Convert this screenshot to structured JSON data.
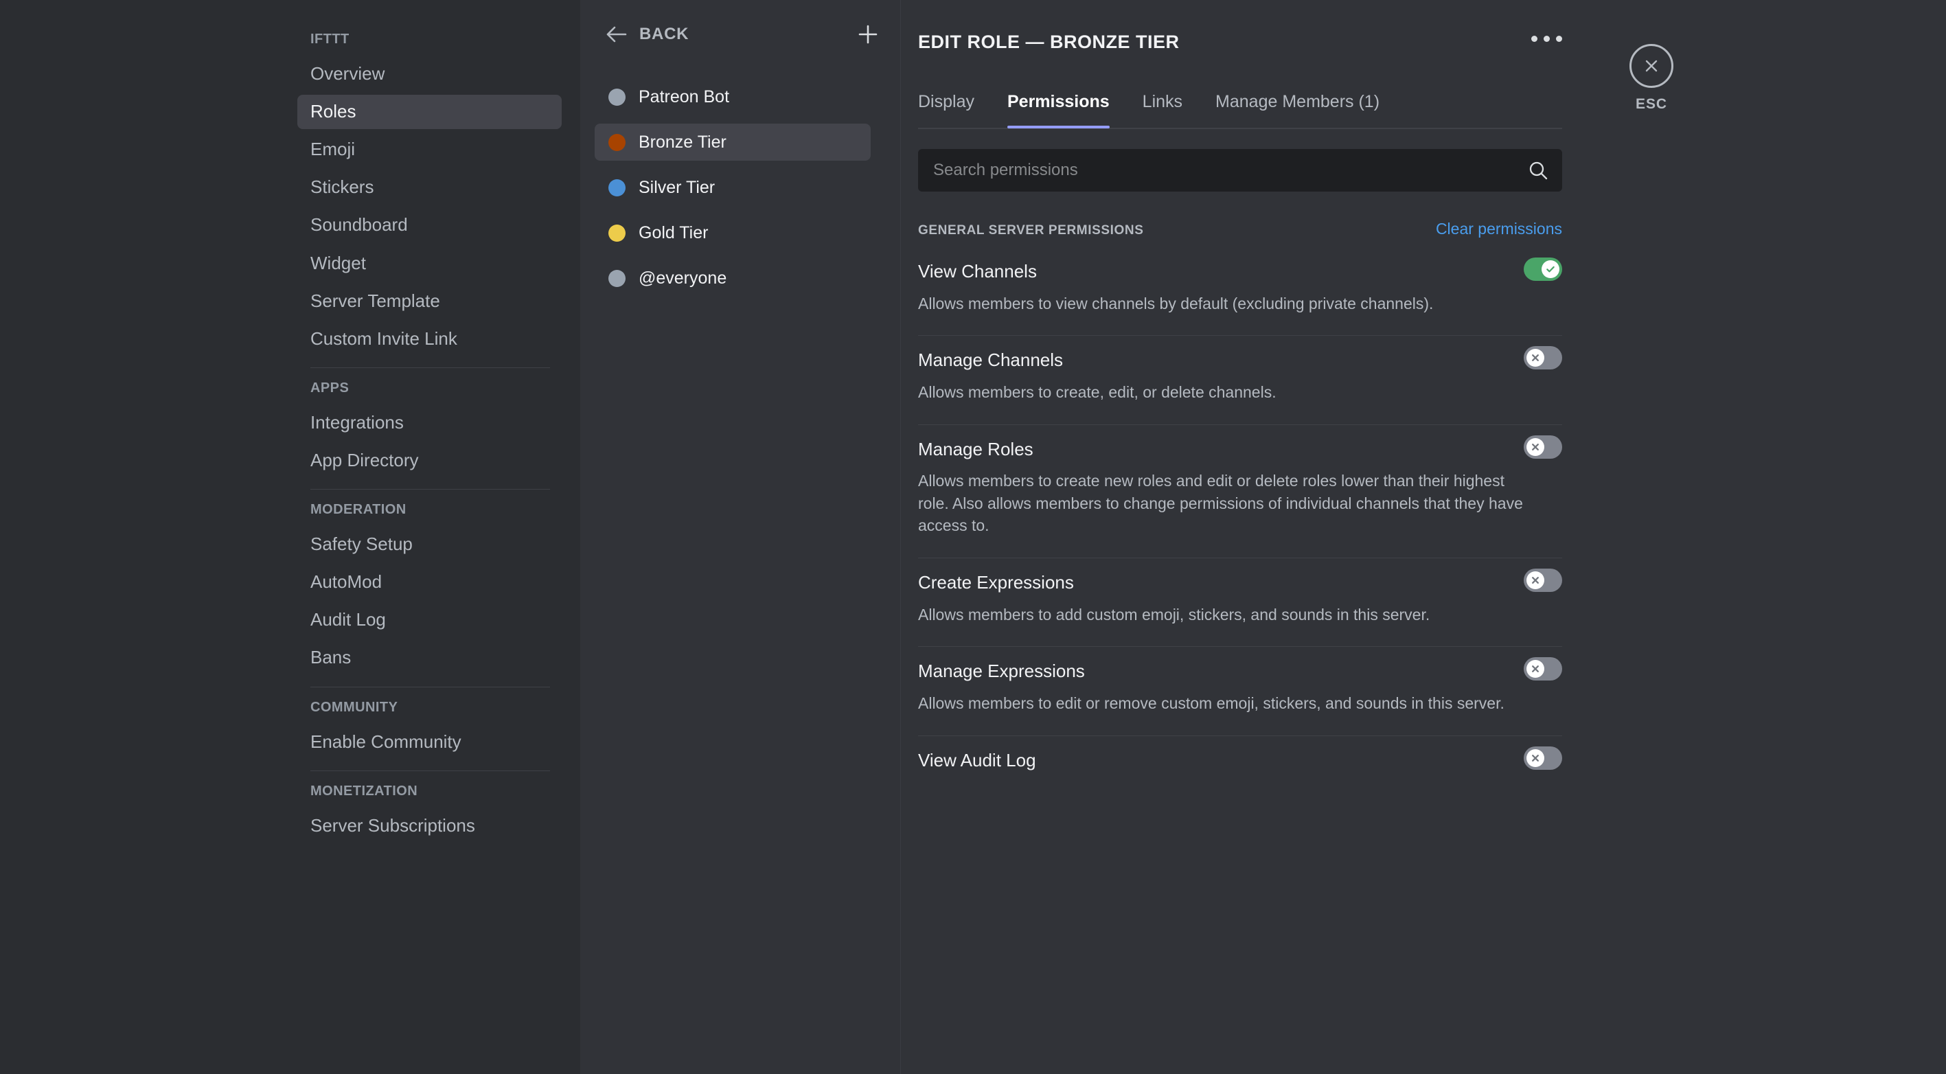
{
  "sidebar": {
    "groups": [
      {
        "header": "IFTTT",
        "items": [
          {
            "label": "Overview",
            "active": false
          },
          {
            "label": "Roles",
            "active": true
          },
          {
            "label": "Emoji",
            "active": false
          },
          {
            "label": "Stickers",
            "active": false
          },
          {
            "label": "Soundboard",
            "active": false
          },
          {
            "label": "Widget",
            "active": false
          },
          {
            "label": "Server Template",
            "active": false
          },
          {
            "label": "Custom Invite Link",
            "active": false
          }
        ]
      },
      {
        "header": "APPS",
        "items": [
          {
            "label": "Integrations",
            "active": false
          },
          {
            "label": "App Directory",
            "active": false
          }
        ]
      },
      {
        "header": "MODERATION",
        "items": [
          {
            "label": "Safety Setup",
            "active": false
          },
          {
            "label": "AutoMod",
            "active": false
          },
          {
            "label": "Audit Log",
            "active": false
          },
          {
            "label": "Bans",
            "active": false
          }
        ]
      },
      {
        "header": "COMMUNITY",
        "items": [
          {
            "label": "Enable Community",
            "active": false
          }
        ]
      },
      {
        "header": "MONETIZATION",
        "items": [
          {
            "label": "Server Subscriptions",
            "active": false
          }
        ]
      }
    ]
  },
  "roles_panel": {
    "back_label": "BACK",
    "add_role_icon": "plus-icon",
    "back_icon": "arrow-left-icon",
    "roles": [
      {
        "name": "Patreon Bot",
        "color": "#9aa4b0",
        "active": false
      },
      {
        "name": "Bronze Tier",
        "color": "#a84300",
        "active": true
      },
      {
        "name": "Silver Tier",
        "color": "#4b90d6",
        "active": false
      },
      {
        "name": "Gold Tier",
        "color": "#edcc4b",
        "active": false
      },
      {
        "name": "@everyone",
        "color": "#9aa4b0",
        "active": false
      }
    ]
  },
  "header": {
    "title": "EDIT ROLE — BRONZE TIER",
    "more_icon": "more-horizontal-icon"
  },
  "tabs": [
    {
      "label": "Display",
      "active": false
    },
    {
      "label": "Permissions",
      "active": true
    },
    {
      "label": "Links",
      "active": false
    },
    {
      "label": "Manage Members (1)",
      "active": false
    }
  ],
  "search": {
    "placeholder": "Search permissions",
    "value": "",
    "icon": "search-icon"
  },
  "permissions_section": {
    "title": "GENERAL SERVER PERMISSIONS",
    "clear_label": "Clear permissions",
    "items": [
      {
        "name": "View Channels",
        "description": "Allows members to view channels by default (excluding private channels).",
        "enabled": true
      },
      {
        "name": "Manage Channels",
        "description": "Allows members to create, edit, or delete channels.",
        "enabled": false
      },
      {
        "name": "Manage Roles",
        "description": "Allows members to create new roles and edit or delete roles lower than their highest role. Also allows members to change permissions of individual channels that they have access to.",
        "enabled": false
      },
      {
        "name": "Create Expressions",
        "description": "Allows members to add custom emoji, stickers, and sounds in this server.",
        "enabled": false
      },
      {
        "name": "Manage Expressions",
        "description": "Allows members to edit or remove custom emoji, stickers, and sounds in this server.",
        "enabled": false
      },
      {
        "name": "View Audit Log",
        "description": "",
        "enabled": false
      }
    ]
  },
  "close": {
    "label": "ESC",
    "icon": "close-icon"
  },
  "colors": {
    "accent": "#949cf7",
    "link": "#4a9eee",
    "toggle_on": "#4aa568",
    "toggle_off": "#80848e",
    "panel": "#313338",
    "sidebar": "#2b2d31"
  }
}
